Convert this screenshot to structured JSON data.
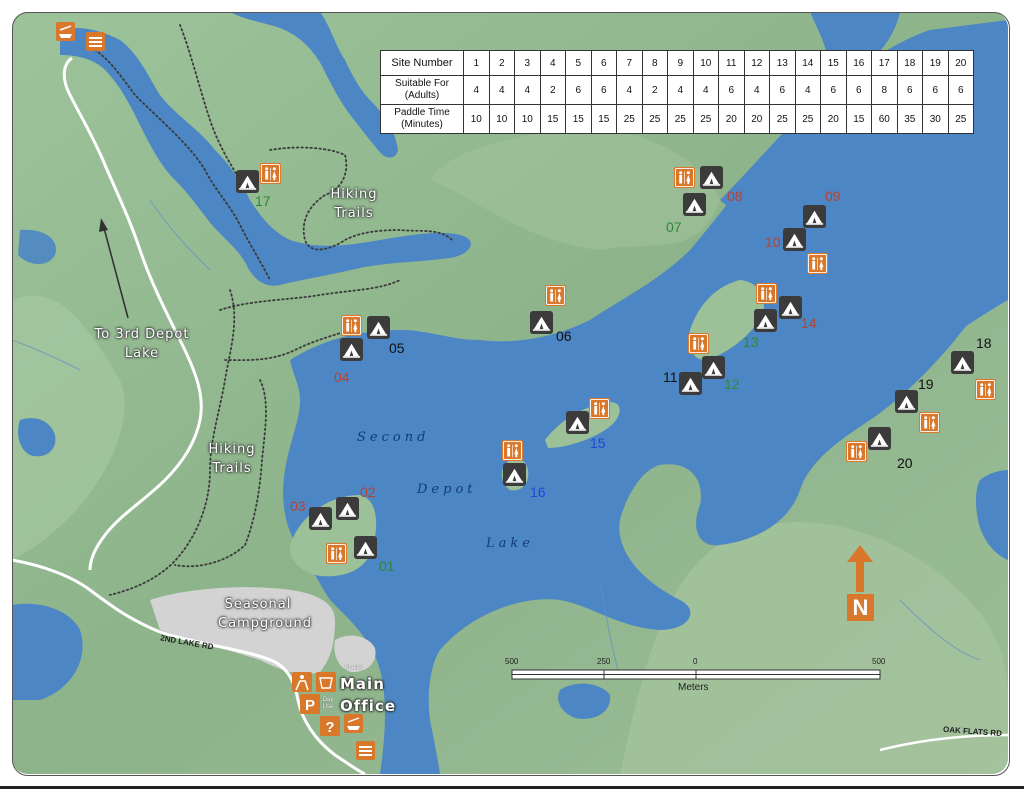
{
  "table": {
    "row_labels": {
      "site_number": "Site Number",
      "suitable_for": "Suitable For (Adults)",
      "paddle_time": "Paddle Time (Minutes)"
    },
    "site_numbers": [
      "1",
      "2",
      "3",
      "4",
      "5",
      "6",
      "7",
      "8",
      "9",
      "10",
      "11",
      "12",
      "13",
      "14",
      "15",
      "16",
      "17",
      "18",
      "19",
      "20"
    ],
    "suitable_for": [
      "4",
      "4",
      "4",
      "2",
      "6",
      "6",
      "4",
      "2",
      "4",
      "4",
      "6",
      "4",
      "6",
      "4",
      "6",
      "6",
      "8",
      "6",
      "6",
      "6"
    ],
    "paddle_time": [
      "10",
      "10",
      "10",
      "15",
      "15",
      "15",
      "25",
      "25",
      "25",
      "25",
      "20",
      "20",
      "25",
      "25",
      "20",
      "15",
      "60",
      "35",
      "30",
      "25"
    ]
  },
  "labels": {
    "hiking_trails": "Hiking Trails",
    "to_3rd_depot_lake": "To 3rd Depot Lake",
    "lake_word_1": "Second",
    "lake_word_2": "Depot",
    "lake_word_3": "Lake",
    "seasonal_campground": "Seasonal Campground",
    "main_office": "Main Office",
    "shelter": "Shelter",
    "day_use": "Day Use",
    "road_2nd_lake": "2ND LAKE RD",
    "road_oak_flats": "OAK FLATS RD"
  },
  "sites": {
    "s01": "01",
    "s02": "02",
    "s03": "03",
    "s04": "04",
    "s05": "05",
    "s06": "06",
    "s07": "07",
    "s08": "08",
    "s09": "09",
    "s10": "10",
    "s11": "11",
    "s12": "12",
    "s13": "13",
    "s14": "14",
    "s15": "15",
    "s16": "16",
    "s17": "17",
    "s18": "18",
    "s19": "19",
    "s20": "20"
  },
  "scale": {
    "t500a": "500",
    "t250": "250",
    "t0": "0",
    "t500b": "500",
    "unit": "Meters"
  },
  "north": "N",
  "icons": [
    "tent-icon",
    "washroom-icon",
    "north-arrow-icon",
    "boat-launch-icon",
    "parking-icon",
    "info-icon",
    "day-use-icon",
    "hiker-icon"
  ],
  "colors": {
    "water": "#4d86c4",
    "land": "#8fb58e",
    "icon_dark": "#3a3a3a",
    "icon_orange": "#d9772b",
    "campground": "#d4d4d4",
    "road": "#ffffff",
    "site_black": "#111111",
    "site_red": "#b8422e",
    "site_green": "#2f8a36",
    "site_blue": "#1e47d8"
  }
}
